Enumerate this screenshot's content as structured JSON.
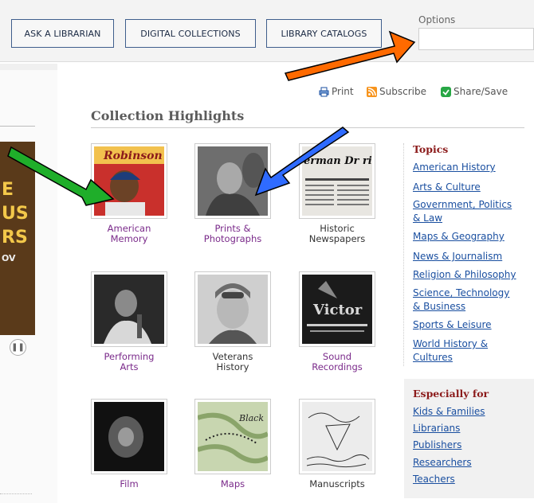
{
  "nav": {
    "ask": "ASK A LIBRARIAN",
    "digital": "DIGITAL COLLECTIONS",
    "catalog": "LIBRARY CATALOGS"
  },
  "options": {
    "label": "Options",
    "value": ""
  },
  "tools": {
    "print": "Print",
    "subscribe": "Subscribe",
    "share": "Share/Save"
  },
  "section_title": "Collection Highlights",
  "collections": [
    {
      "label1": "American",
      "label2": "Memory"
    },
    {
      "label1": "Prints &",
      "label2": "Photographs"
    },
    {
      "label1": "Historic",
      "label2": "Newspapers"
    },
    {
      "label1": "Performing",
      "label2": "Arts"
    },
    {
      "label1": "Veterans",
      "label2": "History"
    },
    {
      "label1": "Sound",
      "label2": "Recordings"
    },
    {
      "label1": "Film",
      "label2": ""
    },
    {
      "label1": "Maps",
      "label2": ""
    },
    {
      "label1": "Manuscripts",
      "label2": ""
    }
  ],
  "thumb_text": {
    "robinson": "Robinson",
    "newspaper": "erman Dr rican Army S",
    "victor": "Victor",
    "black": "Black"
  },
  "banner_text": [
    "E",
    "US",
    "RS",
    "OV"
  ],
  "topics": {
    "heading": "Topics",
    "items": [
      "American History",
      "Arts & Culture",
      "Government, Politics",
      "& Law",
      "Maps & Geography",
      "News & Journalism",
      "Religion & Philosophy",
      "Science, Technology",
      "& Business",
      "Sports & Leisure",
      "World History &",
      "Cultures"
    ]
  },
  "especially": {
    "heading": "Especially for",
    "items": [
      "Kids & Families",
      "Librarians",
      "Publishers",
      "Researchers",
      "Teachers"
    ]
  },
  "colors": {
    "accent_nav": "#3f5e8c",
    "link": "#1a4fa0",
    "tile_label": "#7a2a8a",
    "sidebar_heading": "#8b1a1a",
    "arrow_orange": "#ff6a00",
    "arrow_green": "#1fae2a",
    "arrow_blue": "#2f6bff"
  }
}
